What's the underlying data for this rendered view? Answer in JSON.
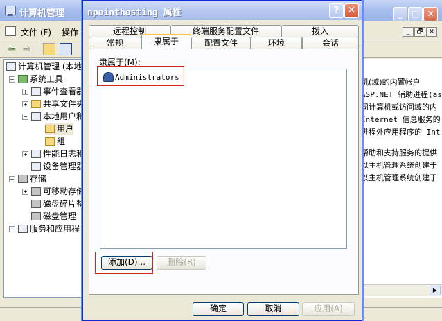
{
  "background_window": {
    "title": "计算机管理",
    "menu": [
      "文件 (F)",
      "操作"
    ],
    "mdi_controls": [
      "_",
      "🗗",
      "✕"
    ],
    "tree": [
      {
        "label": "计算机管理 (本地",
        "icon": "computer-icon",
        "level": 0
      },
      {
        "label": "系统工具",
        "icon": "tools-icon",
        "level": 1
      },
      {
        "label": "事件查看器",
        "icon": "event-viewer-icon",
        "level": 2
      },
      {
        "label": "共享文件夹",
        "icon": "shared-folder-icon",
        "level": 2
      },
      {
        "label": "本地用户和",
        "icon": "users-icon",
        "level": 2
      },
      {
        "label": "用户",
        "icon": "folder-icon",
        "level": 3
      },
      {
        "label": "组",
        "icon": "folder-icon",
        "level": 3
      },
      {
        "label": "性能日志和",
        "icon": "performance-icon",
        "level": 2
      },
      {
        "label": "设备管理器",
        "icon": "device-manager-icon",
        "level": 2
      },
      {
        "label": "存储",
        "icon": "storage-icon",
        "level": 1
      },
      {
        "label": "可移动存储",
        "icon": "removable-storage-icon",
        "level": 2
      },
      {
        "label": "磁盘碎片整",
        "icon": "defrag-icon",
        "level": 2
      },
      {
        "label": "磁盘管理",
        "icon": "disk-management-icon",
        "level": 2
      },
      {
        "label": "服务和应用程",
        "icon": "services-icon",
        "level": 1
      }
    ],
    "descriptions": [
      "机(域)的内置帐户",
      "ASP.NET 辅助进程(as",
      "司计算机或访问域的内",
      "Internet 信息服务的",
      "进程外应用程序的 Int",
      "帮助和支持服务的提供",
      "以主机管理系统创建于",
      "以主机管理系统创建于"
    ]
  },
  "dialog": {
    "title": "npointhosting 属性",
    "tabs_row_back": [
      "远程控制",
      "终端服务配置文件",
      "拨入"
    ],
    "tabs_row_front": [
      "常规",
      "隶属于",
      "配置文件",
      "环境",
      "会话"
    ],
    "active_tab": "隶属于",
    "member_of_label": "隶属于(M):",
    "members": [
      "Administrators"
    ],
    "add_button": "添加(D)...",
    "remove_button": "删除(R)",
    "ok_button": "确定",
    "cancel_button": "取消",
    "apply_button": "应用(A)"
  },
  "colors": {
    "highlight": "#d0241a",
    "title_bar": "#a7bdee",
    "dialog_bg": "#ece9d8"
  }
}
